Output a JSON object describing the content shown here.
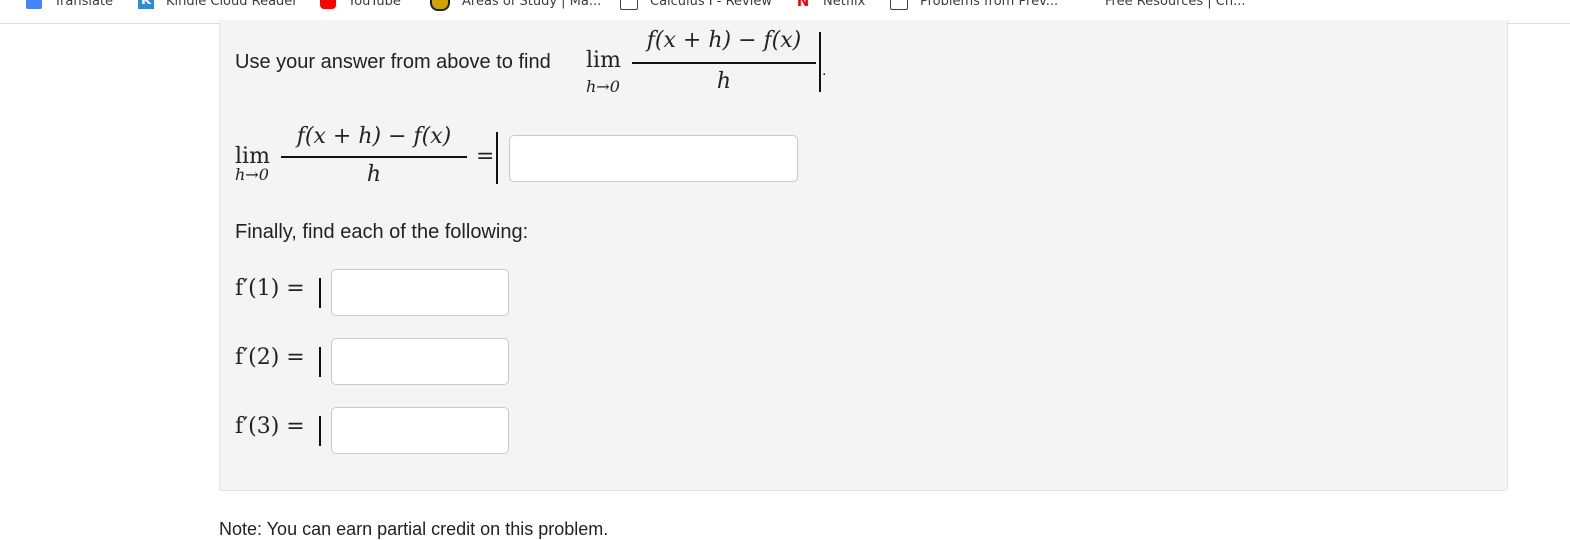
{
  "bookmarks": [
    {
      "label": "Translate",
      "icon": "translate-icon"
    },
    {
      "label": "Kindle Cloud Reader",
      "icon": "kindle-icon"
    },
    {
      "label": "YouTube",
      "icon": "youtube-icon"
    },
    {
      "label": "Areas of Study | Ma...",
      "icon": "shield-icon"
    },
    {
      "label": "Calculus I - Review",
      "icon": "page-icon"
    },
    {
      "label": "Netflix",
      "icon": "netflix-icon"
    },
    {
      "label": "Problems from Prev...",
      "icon": "page-icon"
    },
    {
      "label": "Free Resources | Ch...",
      "icon": ""
    }
  ],
  "problem": {
    "intro_text": "Use your answer from above to find",
    "lim_word": "lim",
    "lim_sub": "h→0",
    "frac_num": "f(x + h) − f(x)",
    "frac_den": "h",
    "period": ".",
    "equals": "=",
    "limit_answer": "",
    "finally_text": "Finally, find each of the following:",
    "derivatives": [
      {
        "label": "f′(1) =",
        "value": ""
      },
      {
        "label": "f′(2) =",
        "value": ""
      },
      {
        "label": "f′(3) =",
        "value": ""
      }
    ]
  },
  "footer_text": "Note: You can earn partial credit on this problem."
}
